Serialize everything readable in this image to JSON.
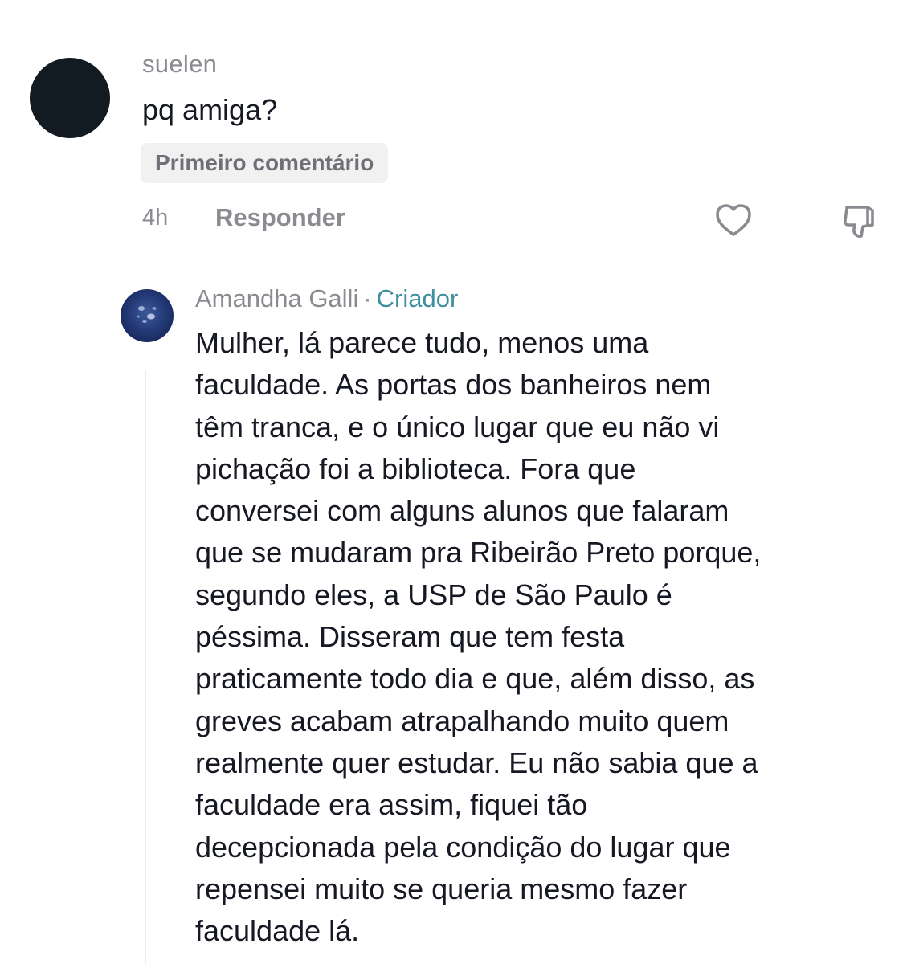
{
  "comment": {
    "username": "suelen",
    "text": "pq amiga?",
    "badge": "Primeiro comentário",
    "time": "4h",
    "reply_label": "Responder",
    "like_icon": "heart-outline-icon",
    "dislike_icon": "thumbs-down-outline-icon"
  },
  "reply": {
    "username": "Amandha Galli",
    "separator": "·",
    "role": "Criador",
    "text": "Mulher, lá parece tudo, menos uma\nfaculdade. As portas dos banheiros nem\ntêm tranca, e o único lugar que eu não vi\npichação foi a biblioteca. Fora que\nconversei com alguns alunos que falaram\nque se mudaram pra Ribeirão Preto porque,\nsegundo eles, a USP de São Paulo é\npéssima. Disseram que tem festa\npraticamente todo dia e que, além disso, as\ngreves acabam atrapalhando muito quem\nrealmente quer estudar. Eu não sabia que a\nfaculdade era assim, fiquei tão\ndecepcionada pela condição do lugar que\nrepensei muito se queria mesmo fazer\nfaculdade lá."
  },
  "colors": {
    "primary_text": "#161823",
    "secondary_text": "#8a8b91",
    "creator_accent": "#3f8f9e",
    "badge_bg": "#f1f1f2"
  }
}
